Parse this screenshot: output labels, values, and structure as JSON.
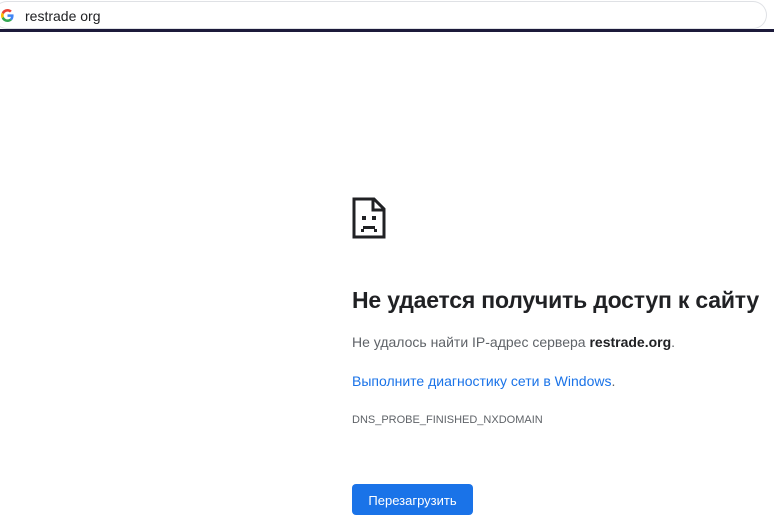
{
  "omnibox": {
    "text": "restrade org",
    "icon": "google-g-icon"
  },
  "error": {
    "icon": "sad-page-icon",
    "title": "Не удается получить доступ к сайту",
    "desc_prefix": "Не удалось найти IP-адрес сервера ",
    "desc_host": "restrade.org",
    "desc_suffix": ".",
    "diagnostics_link": "Выполните диагностику сети в Windows",
    "diagnostics_punct": ".",
    "error_code": "DNS_PROBE_FINISHED_NXDOMAIN",
    "reload_label": "Перезагрузить"
  },
  "colors": {
    "link": "#1a73e8",
    "button": "#1a73e8",
    "title": "#202124",
    "text": "#5f6368"
  }
}
